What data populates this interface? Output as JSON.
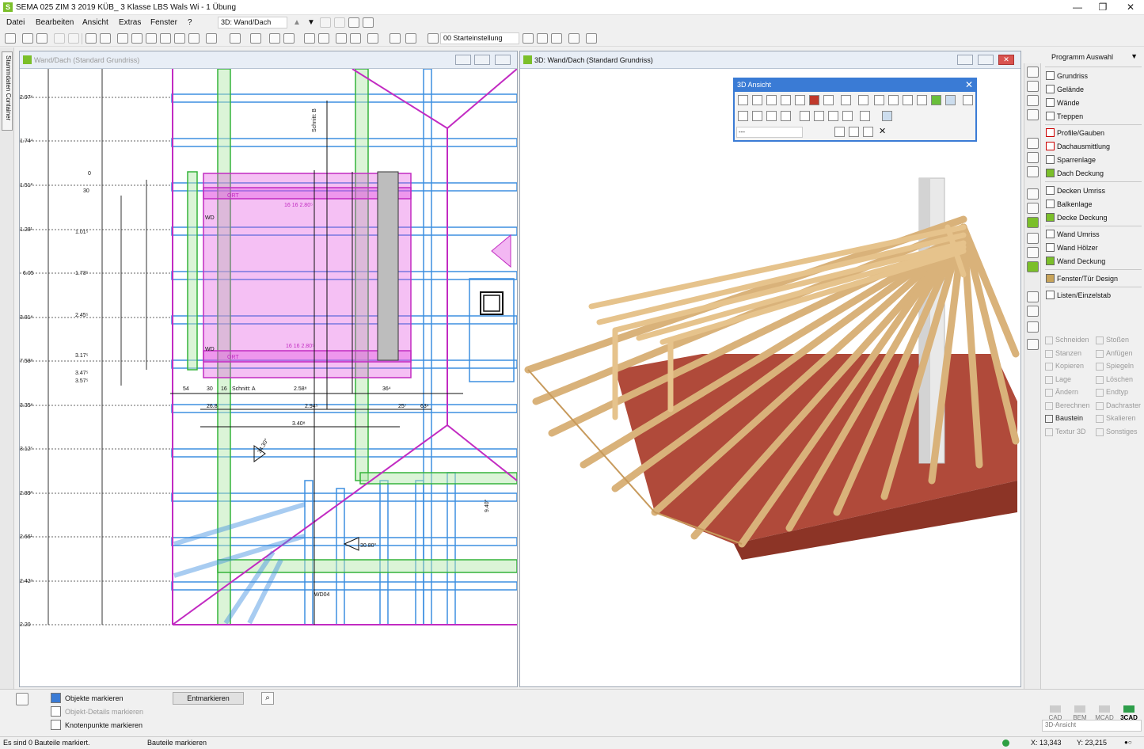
{
  "titlebar": {
    "title": "SEMA  025 ZIM 3 2019 KÜB_ 3 Klasse LBS Wals Wi - 1 Übung",
    "minimize": "—",
    "restore": "❐",
    "close": "✕"
  },
  "menu": {
    "items": [
      "Datei",
      "Bearbeiten",
      "Ansicht",
      "Extras",
      "Fenster",
      "?"
    ],
    "view_combo": "3D: Wand/Dach"
  },
  "toolbar": {
    "start_combo": "00 Starteinstellung"
  },
  "leftstrip": {
    "tab": "Stammdaten Container"
  },
  "plan_window": {
    "title": "Wand/Dach (Standard Grundriss)",
    "elevations": [
      "2.97⁶",
      "1.74⁴",
      "1.51²",
      "1.28¹",
      "6.05",
      "3.81⁸",
      "7.58⁸",
      "3.35⁸",
      "3.12⁵",
      "2.89³",
      "2.66¹",
      "2.42⁹",
      "2.20"
    ],
    "dims_inner": [
      "0",
      "30",
      "1.01⁵",
      "1.73⁵",
      "2.45⁵",
      "3.17⁵",
      "3.47⁵",
      "3.57⁵"
    ],
    "labels": {
      "ort1": "ORT",
      "ort2": "ORT",
      "wd1": "WD",
      "wd2": "WD",
      "wd04": "WD04",
      "schnitt_a": "Schnitt: A",
      "schnitt_b": "Schnitt: B",
      "d254": "54",
      "d230": "30",
      "d16": "16",
      "d258": "2.58⁸",
      "d36": "36⁴",
      "d268": "26.8",
      "d294": "2.94⁵",
      "d25": "25⁷",
      "d63": "63⁴",
      "d340": "3.40⁸",
      "tag1": "16  16  2.80⁵",
      "tag2": "16  16  2.80⁵",
      "angle1": "30.80°",
      "angle2": "34.30°",
      "len940": "9.40°"
    }
  },
  "view3d_window": {
    "title": "3D: Wand/Dach (Standard Grundriss)"
  },
  "panel3d": {
    "title": "3D Ansicht",
    "combo": "---"
  },
  "program": {
    "header": "Programm Auswahl",
    "groups": [
      [
        "Grundriss",
        "Gelände",
        "Wände",
        "Treppen"
      ],
      [
        "Profile/Gauben",
        "Dachausmittlung",
        "Sparrenlage",
        "Dach Deckung"
      ],
      [
        "Decken Umriss",
        "Balkenlage",
        "Decke Deckung"
      ],
      [
        "Wand Umriss",
        "Wand Hölzer",
        "Wand Deckung"
      ],
      [
        "Fenster/Tür Design"
      ],
      [
        "Listen/Einzelstab"
      ]
    ],
    "actions": [
      [
        "Schneiden",
        "Stoßen"
      ],
      [
        "Stanzen",
        "Anfügen"
      ],
      [
        "Kopieren",
        "Spiegeln"
      ],
      [
        "Lage",
        "Löschen"
      ],
      [
        "Ändern",
        "Endtyp"
      ],
      [
        "Berechnen",
        "Dachraster"
      ],
      [
        "Baustein",
        "Skalieren"
      ],
      [
        "Textur 3D",
        "Sonstiges"
      ]
    ]
  },
  "bottom": {
    "mark_objects": "Objekte markieren",
    "mark_details": "Objekt-Details markieren",
    "mark_nodes": "Knotenpunkte markieren",
    "unmark": "Entmarkieren",
    "cad_tabs": [
      "CAD",
      "BEM",
      "MCAD",
      "3CAD"
    ],
    "view_combo": "3D-Ansicht"
  },
  "status": {
    "left": "Es sind 0 Bauteile markiert.",
    "mid": "Bauteile markieren",
    "x": "X: 13,343",
    "y": "Y: 23,215"
  }
}
